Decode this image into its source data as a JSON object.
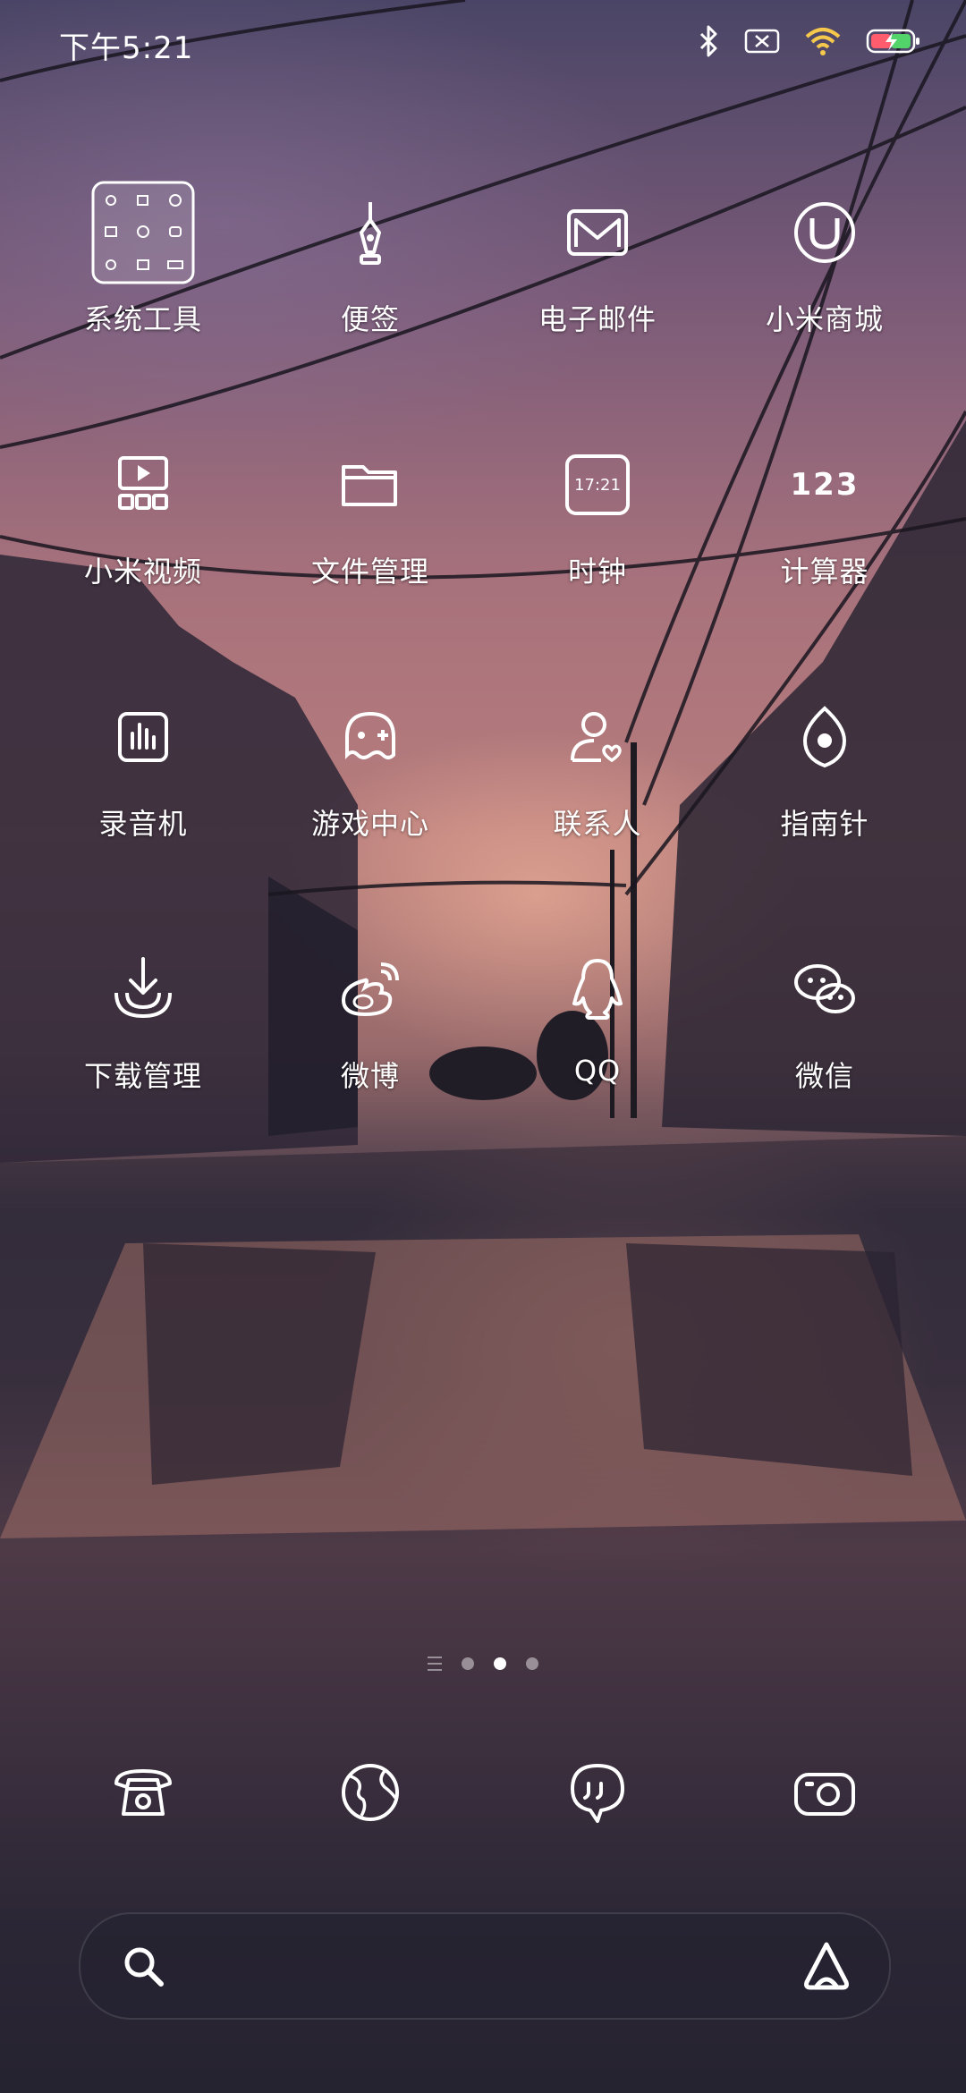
{
  "status_bar": {
    "time": "下午5:21",
    "icons": [
      "bluetooth-icon",
      "sim-disabled-icon",
      "wifi-icon",
      "battery-charging-icon"
    ]
  },
  "apps": [
    {
      "label": "系统工具",
      "icon": "folder-tools-icon"
    },
    {
      "label": "便签",
      "icon": "pen-nib-icon"
    },
    {
      "label": "电子邮件",
      "icon": "mail-icon"
    },
    {
      "label": "小米商城",
      "icon": "mi-store-icon"
    },
    {
      "label": "小米视频",
      "icon": "video-icon"
    },
    {
      "label": "文件管理",
      "icon": "folder-icon"
    },
    {
      "label": "时钟",
      "icon": "clock-icon",
      "clock_text": "17:21"
    },
    {
      "label": "计算器",
      "icon": "calculator-icon",
      "calc_text": "123"
    },
    {
      "label": "录音机",
      "icon": "recorder-icon"
    },
    {
      "label": "游戏中心",
      "icon": "game-icon"
    },
    {
      "label": "联系人",
      "icon": "contacts-icon"
    },
    {
      "label": "指南针",
      "icon": "compass-icon"
    },
    {
      "label": "下载管理",
      "icon": "download-icon"
    },
    {
      "label": "微博",
      "icon": "weibo-icon"
    },
    {
      "label": "QQ",
      "icon": "qq-icon"
    },
    {
      "label": "微信",
      "icon": "wechat-icon"
    }
  ],
  "pager": {
    "pages": 3,
    "current": 2
  },
  "dock": [
    {
      "icon": "phone-icon"
    },
    {
      "icon": "browser-globe-icon"
    },
    {
      "icon": "messages-icon"
    },
    {
      "icon": "camera-icon"
    }
  ],
  "search": {
    "placeholder": "",
    "value": ""
  }
}
